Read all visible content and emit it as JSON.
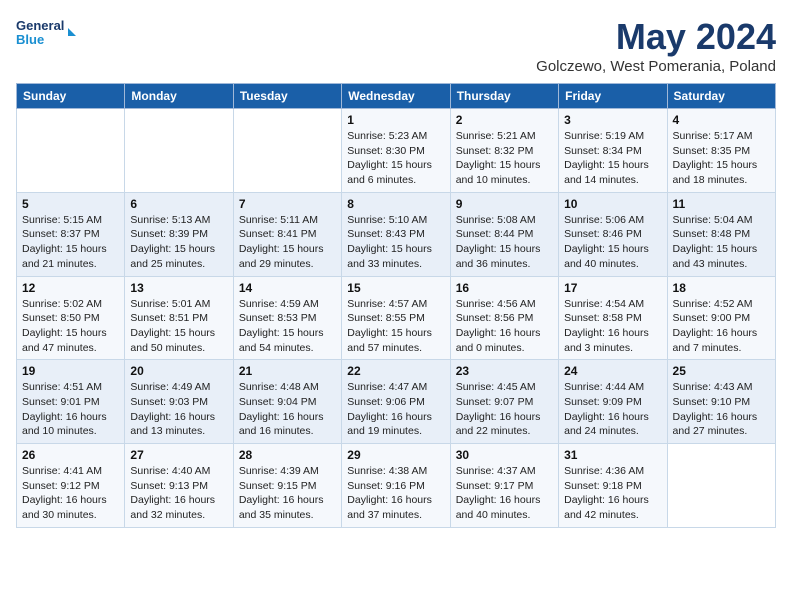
{
  "header": {
    "logo_line1": "General",
    "logo_line2": "Blue",
    "month_year": "May 2024",
    "location": "Golczewo, West Pomerania, Poland"
  },
  "weekdays": [
    "Sunday",
    "Monday",
    "Tuesday",
    "Wednesday",
    "Thursday",
    "Friday",
    "Saturday"
  ],
  "weeks": [
    [
      {
        "day": "",
        "info": ""
      },
      {
        "day": "",
        "info": ""
      },
      {
        "day": "",
        "info": ""
      },
      {
        "day": "1",
        "info": "Sunrise: 5:23 AM\nSunset: 8:30 PM\nDaylight: 15 hours\nand 6 minutes."
      },
      {
        "day": "2",
        "info": "Sunrise: 5:21 AM\nSunset: 8:32 PM\nDaylight: 15 hours\nand 10 minutes."
      },
      {
        "day": "3",
        "info": "Sunrise: 5:19 AM\nSunset: 8:34 PM\nDaylight: 15 hours\nand 14 minutes."
      },
      {
        "day": "4",
        "info": "Sunrise: 5:17 AM\nSunset: 8:35 PM\nDaylight: 15 hours\nand 18 minutes."
      }
    ],
    [
      {
        "day": "5",
        "info": "Sunrise: 5:15 AM\nSunset: 8:37 PM\nDaylight: 15 hours\nand 21 minutes."
      },
      {
        "day": "6",
        "info": "Sunrise: 5:13 AM\nSunset: 8:39 PM\nDaylight: 15 hours\nand 25 minutes."
      },
      {
        "day": "7",
        "info": "Sunrise: 5:11 AM\nSunset: 8:41 PM\nDaylight: 15 hours\nand 29 minutes."
      },
      {
        "day": "8",
        "info": "Sunrise: 5:10 AM\nSunset: 8:43 PM\nDaylight: 15 hours\nand 33 minutes."
      },
      {
        "day": "9",
        "info": "Sunrise: 5:08 AM\nSunset: 8:44 PM\nDaylight: 15 hours\nand 36 minutes."
      },
      {
        "day": "10",
        "info": "Sunrise: 5:06 AM\nSunset: 8:46 PM\nDaylight: 15 hours\nand 40 minutes."
      },
      {
        "day": "11",
        "info": "Sunrise: 5:04 AM\nSunset: 8:48 PM\nDaylight: 15 hours\nand 43 minutes."
      }
    ],
    [
      {
        "day": "12",
        "info": "Sunrise: 5:02 AM\nSunset: 8:50 PM\nDaylight: 15 hours\nand 47 minutes."
      },
      {
        "day": "13",
        "info": "Sunrise: 5:01 AM\nSunset: 8:51 PM\nDaylight: 15 hours\nand 50 minutes."
      },
      {
        "day": "14",
        "info": "Sunrise: 4:59 AM\nSunset: 8:53 PM\nDaylight: 15 hours\nand 54 minutes."
      },
      {
        "day": "15",
        "info": "Sunrise: 4:57 AM\nSunset: 8:55 PM\nDaylight: 15 hours\nand 57 minutes."
      },
      {
        "day": "16",
        "info": "Sunrise: 4:56 AM\nSunset: 8:56 PM\nDaylight: 16 hours\nand 0 minutes."
      },
      {
        "day": "17",
        "info": "Sunrise: 4:54 AM\nSunset: 8:58 PM\nDaylight: 16 hours\nand 3 minutes."
      },
      {
        "day": "18",
        "info": "Sunrise: 4:52 AM\nSunset: 9:00 PM\nDaylight: 16 hours\nand 7 minutes."
      }
    ],
    [
      {
        "day": "19",
        "info": "Sunrise: 4:51 AM\nSunset: 9:01 PM\nDaylight: 16 hours\nand 10 minutes."
      },
      {
        "day": "20",
        "info": "Sunrise: 4:49 AM\nSunset: 9:03 PM\nDaylight: 16 hours\nand 13 minutes."
      },
      {
        "day": "21",
        "info": "Sunrise: 4:48 AM\nSunset: 9:04 PM\nDaylight: 16 hours\nand 16 minutes."
      },
      {
        "day": "22",
        "info": "Sunrise: 4:47 AM\nSunset: 9:06 PM\nDaylight: 16 hours\nand 19 minutes."
      },
      {
        "day": "23",
        "info": "Sunrise: 4:45 AM\nSunset: 9:07 PM\nDaylight: 16 hours\nand 22 minutes."
      },
      {
        "day": "24",
        "info": "Sunrise: 4:44 AM\nSunset: 9:09 PM\nDaylight: 16 hours\nand 24 minutes."
      },
      {
        "day": "25",
        "info": "Sunrise: 4:43 AM\nSunset: 9:10 PM\nDaylight: 16 hours\nand 27 minutes."
      }
    ],
    [
      {
        "day": "26",
        "info": "Sunrise: 4:41 AM\nSunset: 9:12 PM\nDaylight: 16 hours\nand 30 minutes."
      },
      {
        "day": "27",
        "info": "Sunrise: 4:40 AM\nSunset: 9:13 PM\nDaylight: 16 hours\nand 32 minutes."
      },
      {
        "day": "28",
        "info": "Sunrise: 4:39 AM\nSunset: 9:15 PM\nDaylight: 16 hours\nand 35 minutes."
      },
      {
        "day": "29",
        "info": "Sunrise: 4:38 AM\nSunset: 9:16 PM\nDaylight: 16 hours\nand 37 minutes."
      },
      {
        "day": "30",
        "info": "Sunrise: 4:37 AM\nSunset: 9:17 PM\nDaylight: 16 hours\nand 40 minutes."
      },
      {
        "day": "31",
        "info": "Sunrise: 4:36 AM\nSunset: 9:18 PM\nDaylight: 16 hours\nand 42 minutes."
      },
      {
        "day": "",
        "info": ""
      }
    ]
  ]
}
